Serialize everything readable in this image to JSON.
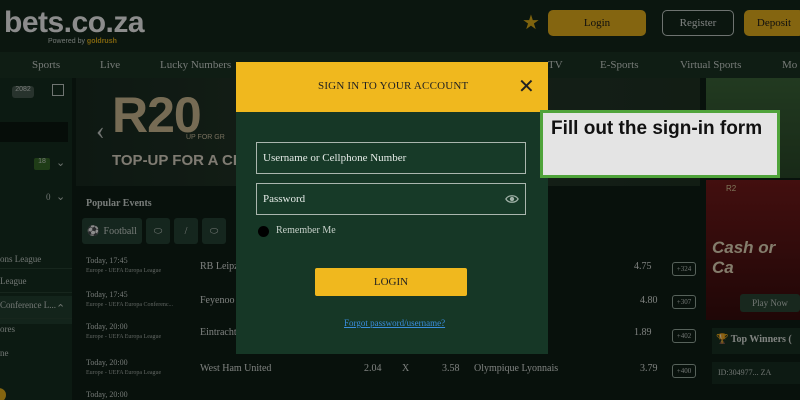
{
  "header": {
    "logo": "bets.co.za",
    "logo_sub_prefix": "Powered by",
    "logo_sub_brand": "goldrush",
    "login_label": "Login",
    "register_label": "Register",
    "deposit_label": "Deposit"
  },
  "nav": {
    "items": [
      "Sports",
      "Live",
      "Lucky Numbers",
      "TV",
      "E-Sports",
      "Virtual Sports",
      "Mo"
    ]
  },
  "sidebar": {
    "badge": "2082",
    "count_a": "18",
    "count_b": "0",
    "leagues": [
      "ons League",
      "League",
      "Conference L...",
      "ores",
      "ne"
    ]
  },
  "banner": {
    "amount": "R20",
    "small_text": "UP FOR GR",
    "headline": "TOP-UP FOR A CH"
  },
  "promo": {
    "r2": "R2",
    "cash": "Cash or Ca",
    "play_now": "Play Now",
    "top_winners": "Top Winners (",
    "winner_id": "ID:304977...",
    "winner_suffix": "ZA"
  },
  "events": {
    "title": "Popular Events",
    "tab_football": "Football",
    "matches": [
      {
        "date": "Today, 17:45",
        "league": "Europe - UEFA Europa League",
        "team": "RB Leipz",
        "odd_right": "4.75",
        "more": "+324"
      },
      {
        "date": "Today, 17:45",
        "league": "Europe - UEFA Europa Conferenc...",
        "team": "Feyenoo",
        "odd_right": "4.80",
        "more": "+307"
      },
      {
        "date": "Today, 20:00",
        "league": "Europe - UEFA Europa League",
        "team": "Eintracht",
        "odd_right": "1.89",
        "more": "+402"
      },
      {
        "date": "Today, 20:00",
        "league": "Europe - UEFA Europa League",
        "team": "West Ham United",
        "odd_1": "2.04",
        "draw": "X",
        "odd_x": "3.58",
        "team_2": "Olympique Lyonnais",
        "odd_right": "3.79",
        "more": "+400"
      },
      {
        "date": "Today, 20:00",
        "league": "",
        "team": "",
        "odd_right": "",
        "more": ""
      }
    ]
  },
  "modal": {
    "title": "SIGN IN TO YOUR ACCOUNT",
    "username_placeholder": "Username or Cellphone Number",
    "password_placeholder": "Password",
    "remember_label": "Remember Me",
    "login_button": "LOGIN",
    "forgot_link": "Forgot password/username?"
  },
  "callout": {
    "text": "Fill out the sign-in form"
  },
  "colors": {
    "accent": "#f0b81e",
    "background": "#0f1f17",
    "modal": "#163726",
    "callout_border": "#4fa33a"
  }
}
